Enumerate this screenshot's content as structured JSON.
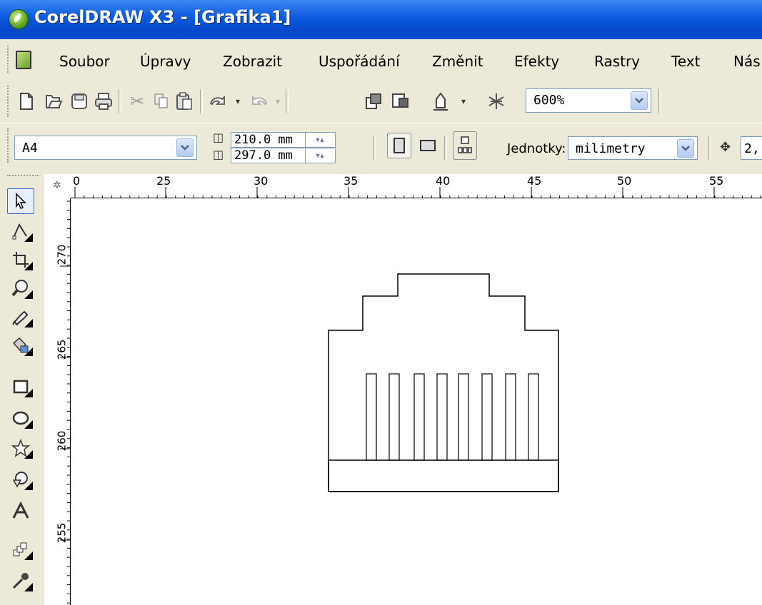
{
  "window": {
    "title": "CorelDRAW X3 - [Grafika1]"
  },
  "menu": [
    {
      "label": "Soubor",
      "name": "menu-soubor"
    },
    {
      "label": "Úpravy",
      "name": "menu-upravy"
    },
    {
      "label": "Zobrazit",
      "name": "menu-zobrazit"
    },
    {
      "label": "Uspořádání",
      "name": "menu-usporadani"
    },
    {
      "label": "Změnit",
      "name": "menu-zmenit"
    },
    {
      "label": "Efekty",
      "name": "menu-efekty"
    },
    {
      "label": "Rastry",
      "name": "menu-rastry"
    },
    {
      "label": "Text",
      "name": "menu-text"
    },
    {
      "label": "Nás",
      "name": "menu-nastroje"
    }
  ],
  "standard_toolbar": {
    "icons": [
      "new-icon",
      "open-icon",
      "save-icon",
      "print-icon",
      "cut-icon",
      "copy-icon",
      "paste-icon",
      "undo-icon",
      "redo-icon",
      "import-icon",
      "export-icon",
      "app-launcher-icon",
      "corel-online-icon"
    ],
    "zoom_value": "600%"
  },
  "property_bar": {
    "paper_size": "A4",
    "width": "210.0 mm",
    "height": "297.0 mm",
    "units_label": "Jednotky:",
    "units_value": "milimetry",
    "nudge_value": "2,"
  },
  "toolbox": [
    "pick-tool-icon",
    "shape-tool-icon",
    "crop-tool-icon",
    "zoom-tool-icon",
    "freehand-tool-icon",
    "smart-fill-tool-icon",
    "rectangle-tool-icon",
    "ellipse-tool-icon",
    "polygon-tool-icon",
    "basic-shapes-tool-icon",
    "text-tool-icon",
    "interactive-blend-tool-icon",
    "eyedropper-tool-icon"
  ],
  "rulers": {
    "horizontal": [
      "0",
      "25",
      "30",
      "35",
      "40",
      "45",
      "50",
      "55"
    ],
    "vertical": [
      "270",
      "265",
      "260",
      "255"
    ]
  }
}
